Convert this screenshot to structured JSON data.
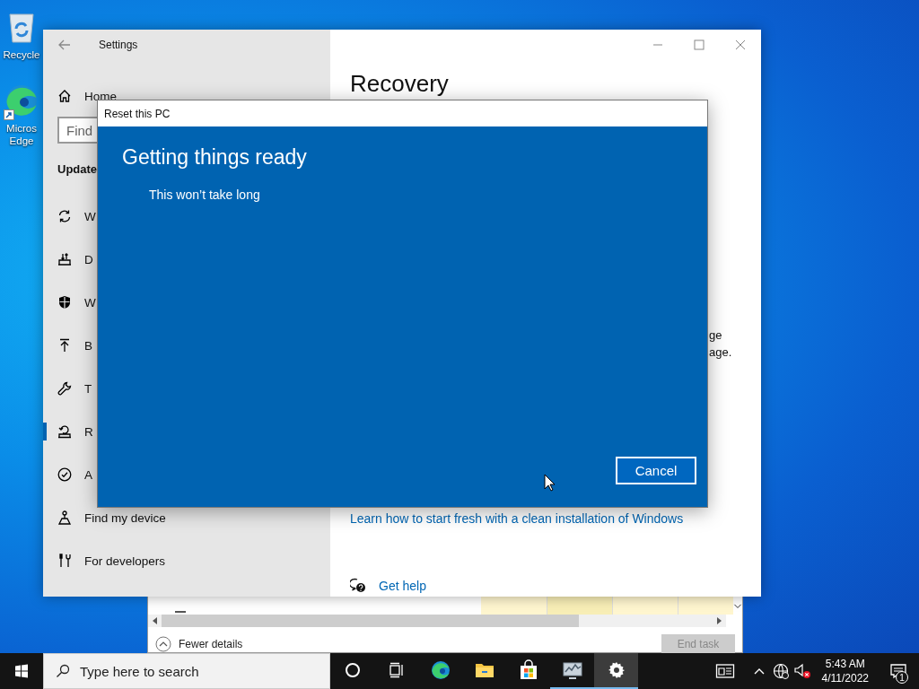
{
  "desktop_icons": [
    {
      "kind": "recycle",
      "label_lines": [
        "Recycle"
      ]
    },
    {
      "kind": "edge",
      "label_lines": [
        "Micros",
        "Edge"
      ]
    }
  ],
  "task_manager": {
    "details_toggle": "Fewer details",
    "end_task": {
      "label": "End task",
      "disabled": true
    }
  },
  "settings": {
    "title": "Settings",
    "home": "Home",
    "search": {
      "placeholder": "Find"
    },
    "section": "Update",
    "nav_items": [
      {
        "label": "W",
        "kind": "sync",
        "selected": false
      },
      {
        "label": "D",
        "kind": "delivery",
        "selected": false
      },
      {
        "label": "W",
        "kind": "shield",
        "selected": false
      },
      {
        "label": "B",
        "kind": "backup",
        "selected": false
      },
      {
        "label": "T",
        "kind": "wrench",
        "selected": false
      },
      {
        "label": "R",
        "kind": "recovery",
        "selected": true
      },
      {
        "label": "A",
        "kind": "activation",
        "selected": false
      },
      {
        "label": "Find my device",
        "kind": "find",
        "selected": false
      },
      {
        "label": "For developers",
        "kind": "developers",
        "selected": false
      }
    ],
    "page": {
      "title": "Recovery",
      "text_lines": [
        "ge",
        "age."
      ],
      "link": "Learn how to start fresh with a clean installation of Windows",
      "help": "Get help"
    }
  },
  "dialog": {
    "title": "Reset this PC",
    "heading": "Getting things ready",
    "message": "This won’t take long",
    "buttons": [
      {
        "label": "Cancel",
        "focused": true
      }
    ]
  },
  "taskbar": {
    "search": {
      "placeholder": "Type here to search"
    },
    "apps": [
      {
        "kind": "cortana",
        "running": false,
        "active": false
      },
      {
        "kind": "taskview",
        "running": false,
        "active": false
      },
      {
        "kind": "edge",
        "running": false,
        "active": false
      },
      {
        "kind": "folder",
        "running": false,
        "active": false
      },
      {
        "kind": "store",
        "running": false,
        "active": false
      },
      {
        "kind": "monitor",
        "running": true,
        "active": false
      },
      {
        "kind": "gear",
        "running": true,
        "active": true
      }
    ],
    "time": "5:43 AM",
    "date": "4/11/2022",
    "notifications": "1"
  }
}
